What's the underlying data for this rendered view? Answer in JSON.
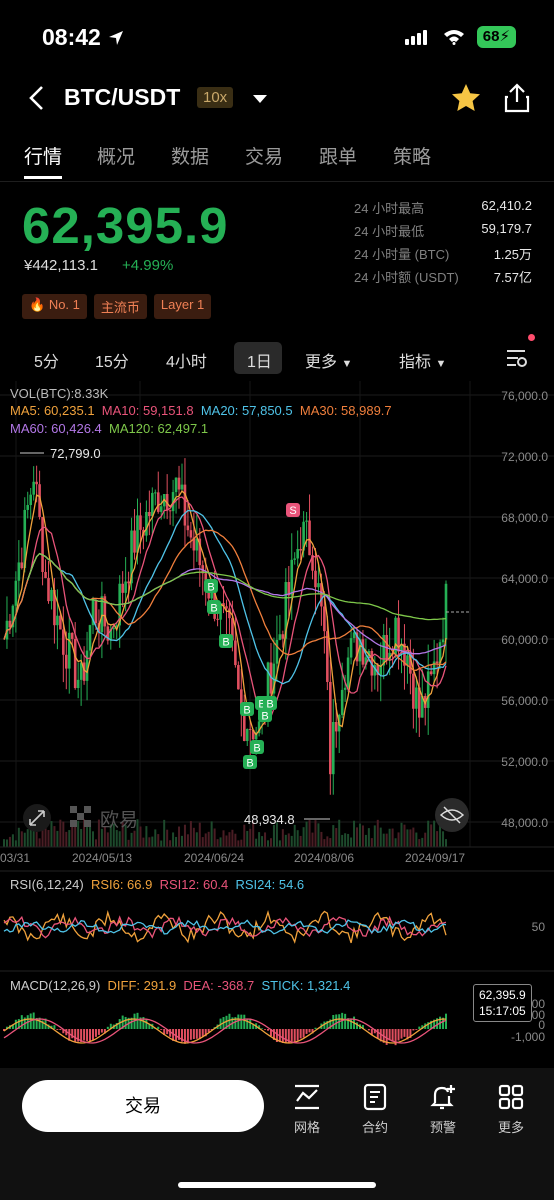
{
  "status": {
    "time": "08:42",
    "battery": "68"
  },
  "header": {
    "pair": "BTC/USDT",
    "leverage": "10x"
  },
  "tabs": [
    "行情",
    "概况",
    "数据",
    "交易",
    "跟单",
    "策略"
  ],
  "price": {
    "last": "62,395.9",
    "cny": "¥442,113.1",
    "change": "+4.99%",
    "stats": [
      {
        "label": "24 小时最高",
        "value": "62,410.2"
      },
      {
        "label": "24 小时最低",
        "value": "59,179.7"
      },
      {
        "label": "24 小时量 (BTC)",
        "value": "1.25万"
      },
      {
        "label": "24 小时额 (USDT)",
        "value": "7.57亿"
      }
    ]
  },
  "tags": [
    "No. 1",
    "主流币",
    "Layer 1"
  ],
  "timeframes": {
    "items": [
      "5分",
      "15分",
      "4小时",
      "1日",
      "更多",
      "指标"
    ],
    "active": "1日"
  },
  "colors": {
    "up": "#25b055",
    "down": "#e04f5f",
    "ma5": "#f0a23c",
    "ma10": "#e9547a",
    "ma20": "#4fc3e8",
    "ma30": "#f07f3c",
    "ma60": "#b277e6",
    "ma120": "#7ec84a"
  },
  "main_chart": {
    "vol_label": "VOL(BTC):8.33K",
    "ma_row1": [
      {
        "text": "MA5: 60,235.1",
        "color": "#f0a23c"
      },
      {
        "text": "MA10: 59,151.8",
        "color": "#e9547a"
      },
      {
        "text": "MA20: 57,850.5",
        "color": "#4fc3e8"
      },
      {
        "text": "MA30: 58,989.7",
        "color": "#f07f3c"
      }
    ],
    "ma_row2": [
      {
        "text": "MA60: 60,426.4",
        "color": "#b277e6"
      },
      {
        "text": "MA120: 62,497.1",
        "color": "#7ec84a"
      }
    ],
    "y_ticks": [
      "76,000.0",
      "72,000.0",
      "68,000.0",
      "64,000.0",
      "60,000.0",
      "56,000.0",
      "52,000.0",
      "48,000.0"
    ],
    "x_ticks": [
      "03/31",
      "2024/05/13",
      "2024/06/24",
      "2024/08/06",
      "2024/09/17"
    ],
    "high_label": "72,799.0",
    "low_label": "48,934.8",
    "last_price": "62,395.9",
    "countdown": "15:17:05",
    "watermark": "欧易"
  },
  "rsi": {
    "label": "RSI(6,12,24)",
    "rsi6": "RSI6: 66.9",
    "rsi12": "RSI12: 60.4",
    "rsi24": "RSI24: 54.6",
    "tick": "50"
  },
  "macd": {
    "label": "MACD(12,26,9)",
    "diff": "DIFF: 291.9",
    "dea": "DEA: -368.7",
    "stick": "STICK: 1,321.4",
    "ticks": [
      "2,000",
      "1,000",
      "0",
      "-1,000"
    ]
  },
  "bottom": {
    "trade": "交易",
    "items": [
      {
        "label": "网格",
        "icon": "grid-chart-icon"
      },
      {
        "label": "合约",
        "icon": "contract-icon"
      },
      {
        "label": "预警",
        "icon": "alert-bell-icon"
      },
      {
        "label": "更多",
        "icon": "more-grid-icon"
      }
    ]
  }
}
